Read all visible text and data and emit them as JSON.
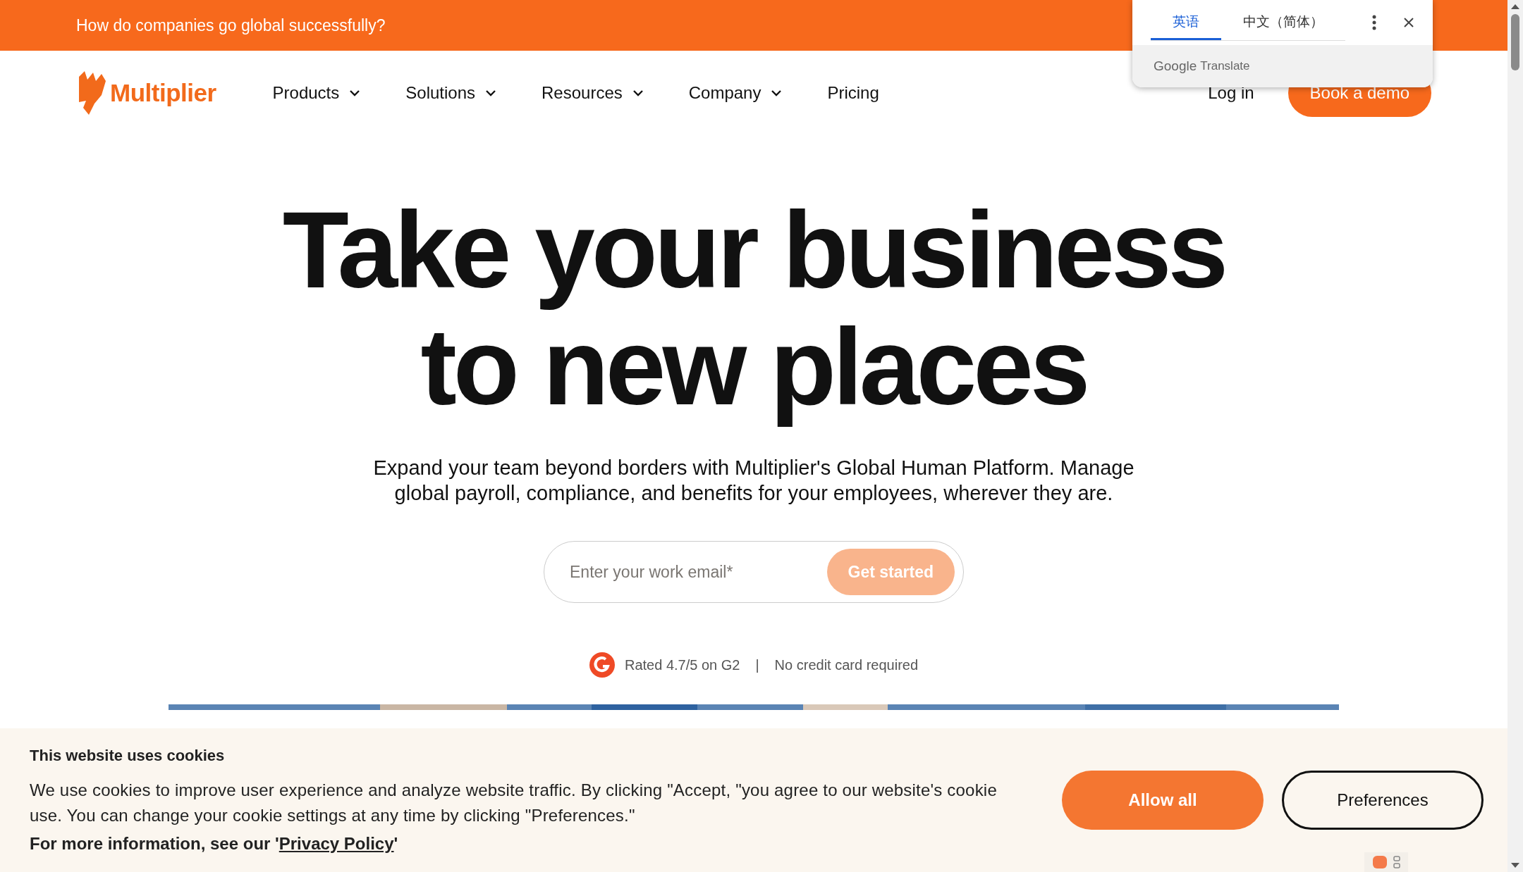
{
  "announcement": {
    "text": "How do companies go global successfully?"
  },
  "nav": {
    "logo": "Multiplier",
    "items": [
      {
        "label": "Products",
        "dropdown": true
      },
      {
        "label": "Solutions",
        "dropdown": true
      },
      {
        "label": "Resources",
        "dropdown": true
      },
      {
        "label": "Company",
        "dropdown": true
      },
      {
        "label": "Pricing",
        "dropdown": false
      }
    ],
    "login": "Log in",
    "cta": "Book a demo"
  },
  "hero": {
    "headline_lines": [
      "Take your business",
      "to new places"
    ],
    "subtitle": "Expand your team beyond borders with Multiplier's Global Human Platform. Manage global payroll, compliance, and benefits for your employees, wherever they are.",
    "email": {
      "placeholder": "Enter your work email*",
      "button": "Get started"
    },
    "rating": "Rated 4.7/5 on G2",
    "separator": "|",
    "note": "No credit card required"
  },
  "translate_popup": {
    "tabs": [
      {
        "label": "英语",
        "selected": true
      },
      {
        "label": "中文（简体）",
        "selected": false
      }
    ],
    "brand": "Google",
    "product": "Translate"
  },
  "cookie_banner": {
    "title": "This website uses cookies",
    "text": "We use cookies to improve user experience and analyze website traffic. By clicking \"Accept, \"you agree to our website's cookie use. You can change your cookie settings at any time by clicking \"Preferences.\"",
    "more_info": "For more information, see our '",
    "link": "Privacy Policy",
    "closing": "'",
    "buttons": [
      {
        "label": "Allow all",
        "kind": "primary"
      },
      {
        "label": "Preferences",
        "kind": "outline"
      }
    ]
  }
}
